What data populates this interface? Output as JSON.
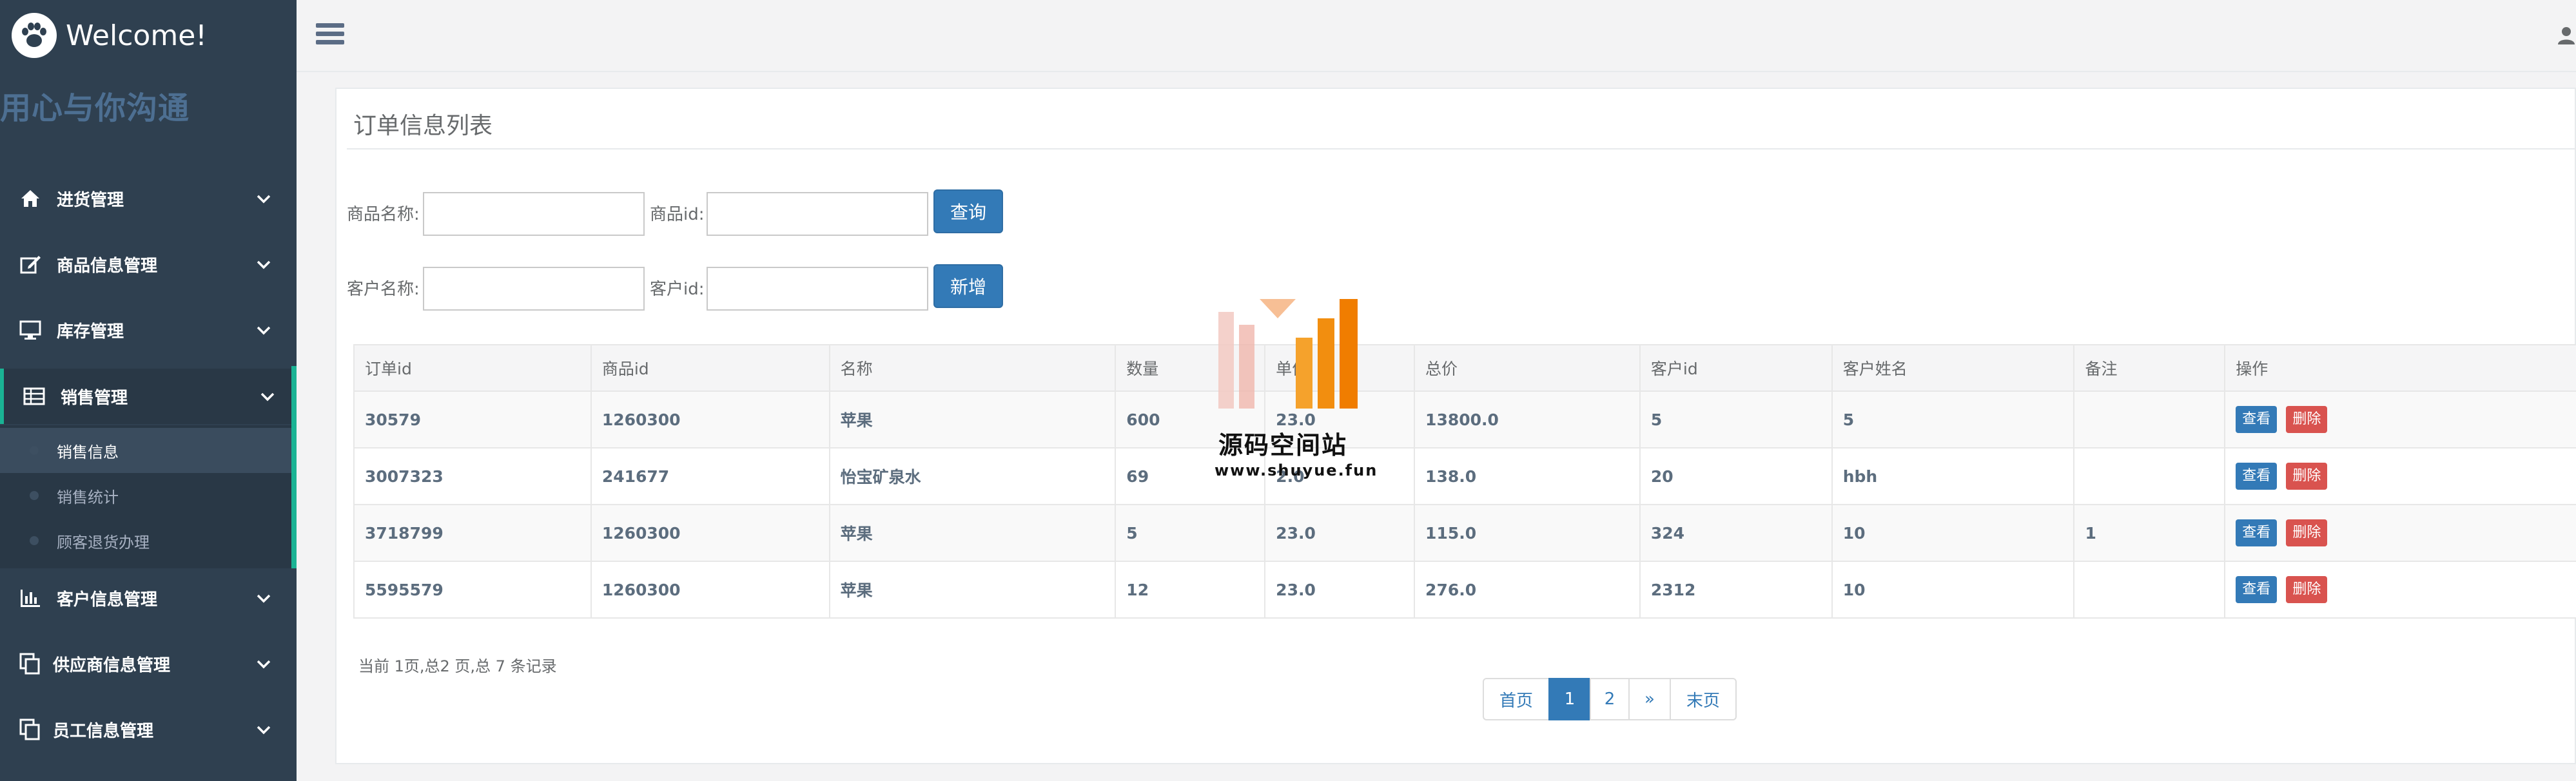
{
  "sidebar": {
    "brand": "Welcome!",
    "slogan": "用心与你沟通",
    "menu": [
      {
        "label": "进货管理",
        "icon": "home-icon"
      },
      {
        "label": "商品信息管理",
        "icon": "edit-icon"
      },
      {
        "label": "库存管理",
        "icon": "desktop-icon"
      },
      {
        "label": "销售管理",
        "icon": "table-icon"
      },
      {
        "label": "客户信息管理",
        "icon": "bar-chart-icon"
      },
      {
        "label": "供应商信息管理",
        "icon": "copy-icon"
      },
      {
        "label": "员工信息管理",
        "icon": "copy-icon"
      }
    ],
    "submenu": [
      {
        "label": "销售信息"
      },
      {
        "label": "销售统计"
      },
      {
        "label": "顾客退货办理"
      }
    ]
  },
  "panel": {
    "title": "订单信息列表"
  },
  "filters": {
    "product_name_label": "商品名称:",
    "product_id_label": "商品id:",
    "customer_name_label": "客户名称:",
    "customer_id_label": "客户id:",
    "query_button": "查询",
    "add_button": "新增"
  },
  "table": {
    "headers": [
      "订单id",
      "商品id",
      "名称",
      "数量",
      "单价",
      "总价",
      "客户id",
      "客户姓名",
      "备注",
      "操作"
    ],
    "rows": [
      [
        "30579",
        "1260300",
        "苹果",
        "600",
        "23.0",
        "13800.0",
        "5",
        "5",
        ""
      ],
      [
        "3007323",
        "241677",
        "怡宝矿泉水",
        "69",
        "2.0",
        "138.0",
        "20",
        "hbh",
        ""
      ],
      [
        "3718799",
        "1260300",
        "苹果",
        "5",
        "23.0",
        "115.0",
        "324",
        "10",
        "1"
      ],
      [
        "5595579",
        "1260300",
        "苹果",
        "12",
        "23.0",
        "276.0",
        "2312",
        "10",
        ""
      ]
    ],
    "view_label": "查看",
    "delete_label": "删除"
  },
  "pagination": {
    "info": "当前 1页,总2 页,总 7 条记录",
    "first": "首页",
    "pages": [
      "1",
      "2"
    ],
    "next": "»",
    "last": "末页"
  },
  "watermark": {
    "name": "源码空间站",
    "url": "www.shuyue.fun"
  }
}
